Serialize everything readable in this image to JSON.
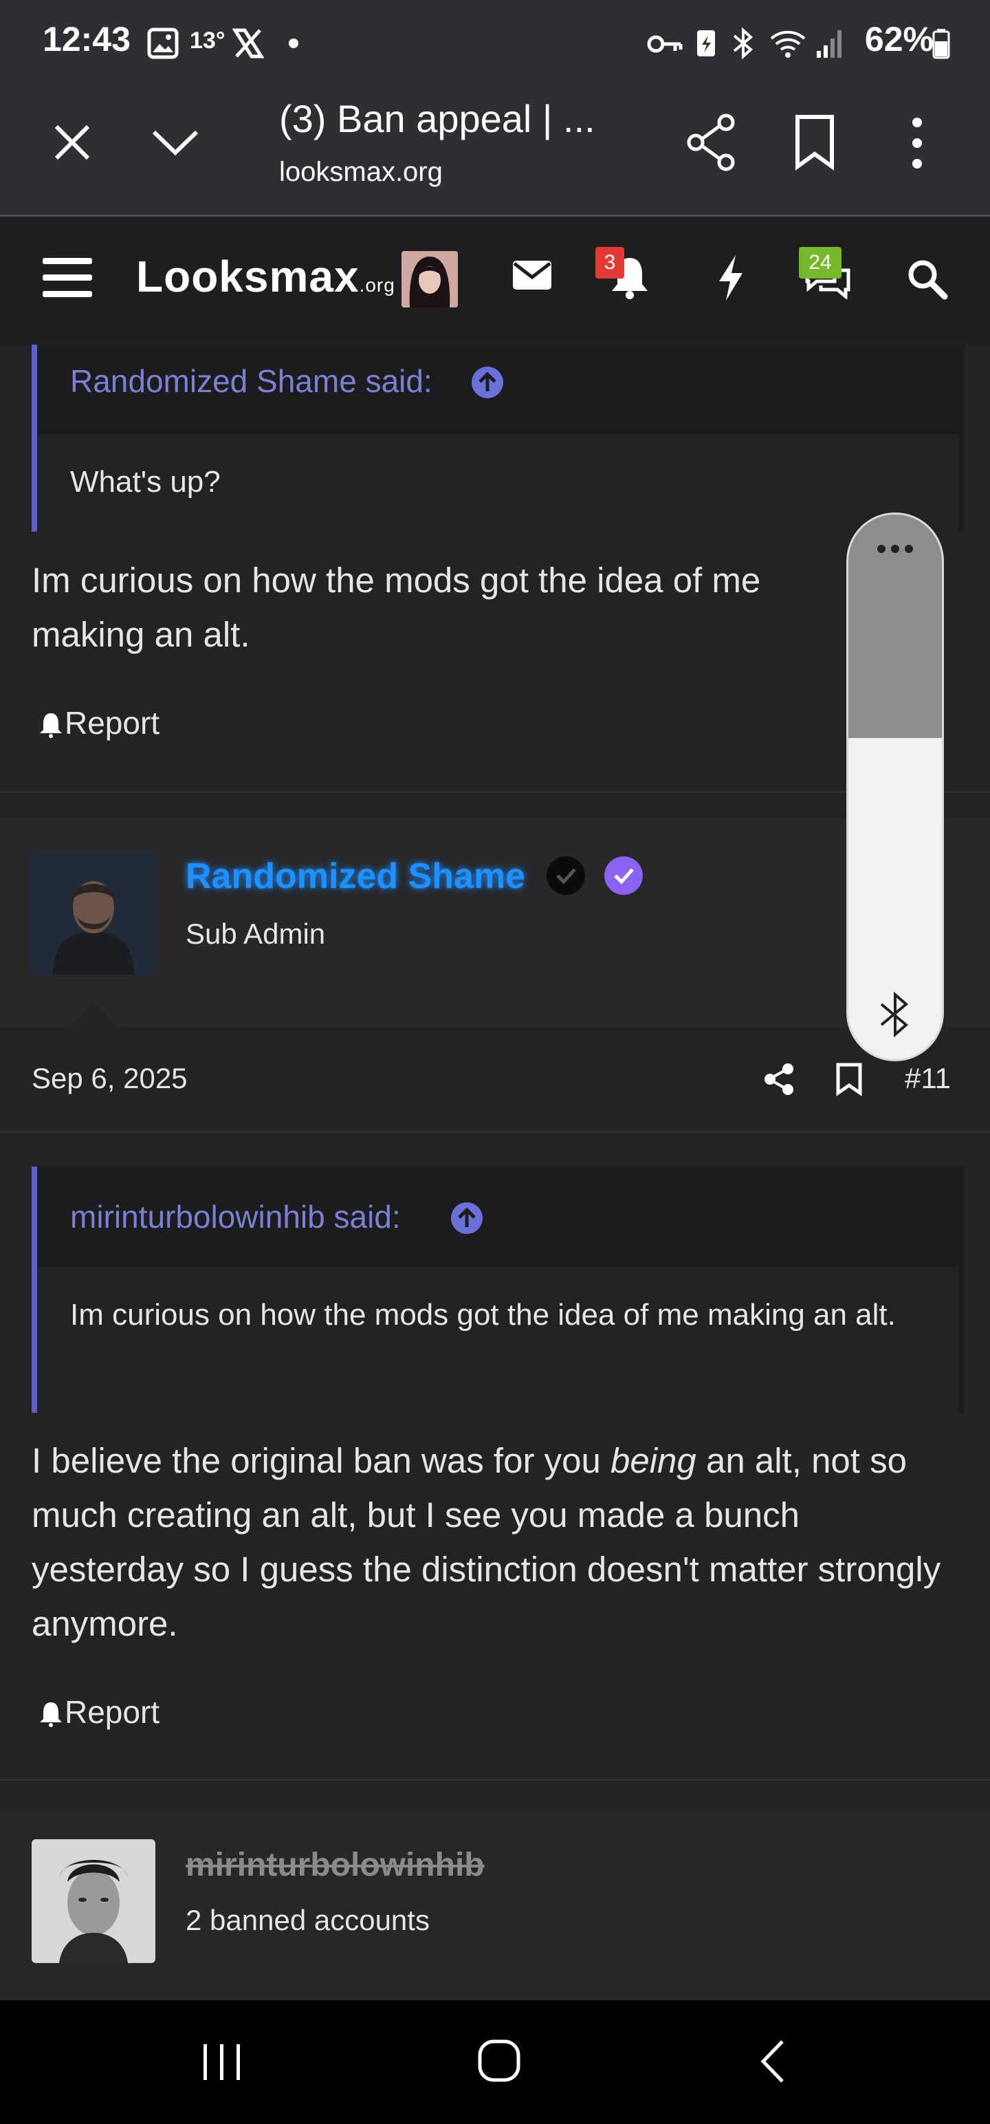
{
  "status_bar": {
    "time": "12:43",
    "temp": "13°",
    "battery_percent": "62%"
  },
  "browser": {
    "tab_title": "(3) Ban appeal | ...",
    "url": "looksmax.org"
  },
  "site": {
    "logo_main": "Looksmax",
    "logo_suffix": ".org",
    "notifications_count": "3",
    "messages_count": "24"
  },
  "posts": {
    "first": {
      "quote_author": "Randomized Shame said:",
      "quote_text": "What's up?",
      "body": "Im curious on how the mods got the idea of me making an alt.",
      "report_label": "Report"
    },
    "second": {
      "username": "Randomized Shame",
      "role": "Sub Admin",
      "date": "Sep 6, 2025",
      "post_number": "#11",
      "quote_author": "mirinturbolowinhib said:",
      "quote_text": "Im curious on how the mods got the idea of me making an alt.",
      "body_before": "I believe the original ban was for you ",
      "body_italic": "being",
      "body_after": " an alt, not so much creating an alt, but I see you made a bunch yesterday so I guess the distinction doesn't matter strongly anymore.",
      "report_label": "Report"
    },
    "third": {
      "username": "mirinturbolowinhib",
      "role": "2 banned accounts"
    }
  },
  "volume_overlay": {
    "level": 0.59
  },
  "colors": {
    "accent": "#5b61c8",
    "username_blue": "#1e90ff",
    "verified_purple": "#8a63f2",
    "notif_red": "#e53935",
    "msg_green": "#76b82a"
  },
  "icons": [
    "close-icon",
    "chevron-down-icon",
    "share-icon",
    "bookmark-icon",
    "more-vert-icon",
    "menu-icon",
    "mail-icon",
    "bell-icon",
    "bolt-icon",
    "chat-icon",
    "search-icon",
    "arrow-up-circle-icon",
    "report-bell-icon",
    "bluetooth-icon",
    "recents-icon",
    "home-icon",
    "back-icon"
  ]
}
